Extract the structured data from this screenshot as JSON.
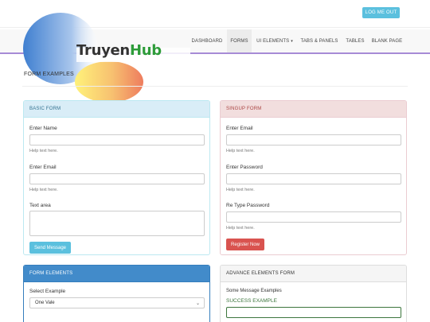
{
  "header": {
    "logout_label": "LOG ME OUT"
  },
  "logo": {
    "part1": "Truyen",
    "part2": "Hub"
  },
  "nav": {
    "items": [
      {
        "label": "DASHBOARD"
      },
      {
        "label": "FORMS"
      },
      {
        "label": "UI ELEMENTS"
      },
      {
        "label": "TABS & PANELS"
      },
      {
        "label": "TABLES"
      },
      {
        "label": "BLANK PAGE"
      }
    ]
  },
  "page": {
    "title": "FORM EXAMPLES"
  },
  "basic_form": {
    "heading": "BASIC FORM",
    "name_label": "Enter Name",
    "name_help": "Help text here.",
    "email_label": "Enter Email",
    "email_help": "Help text here.",
    "textarea_label": "Text area",
    "submit_label": "Send Message"
  },
  "signup_form": {
    "heading": "SINGUP FORM",
    "email_label": "Enter Email",
    "email_help": "Help text here.",
    "password_label": "Enter Password",
    "password_help": "Help text here.",
    "retype_label": "Re Type Password",
    "retype_help": "Help text here.",
    "submit_label": "Register Now"
  },
  "form_elements": {
    "heading": "FORM ELEMENTS",
    "select_label": "Select Example",
    "select_value": "One Vale"
  },
  "advance_form": {
    "heading": "ADVANCE ELEMENTS FORM",
    "message_label": "Some Message Examples",
    "success_label": "SUCCESS EXAMPLE"
  },
  "colors": {
    "info": "#5bc0de",
    "danger": "#d9534f",
    "primary": "#428bca",
    "nav_accent": "#a78bd6",
    "success": "#3c763d"
  }
}
